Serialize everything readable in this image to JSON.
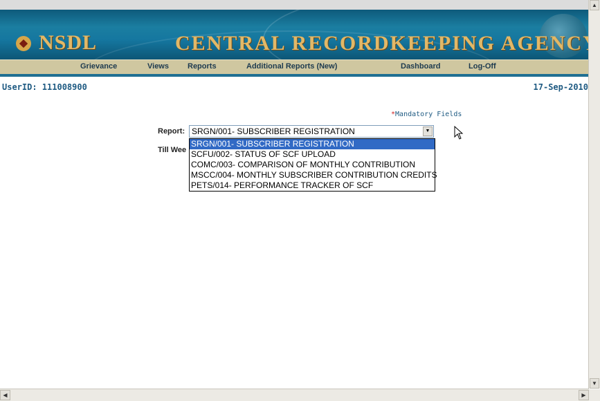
{
  "header": {
    "logo": "NSDL",
    "title": "CENTRAL RECORDKEEPING AGENCY"
  },
  "nav": {
    "items": [
      {
        "label": "Grievance"
      },
      {
        "label": "Views"
      },
      {
        "label": "Reports"
      },
      {
        "label": "Additional Reports (New)"
      },
      {
        "label": "Dashboard"
      },
      {
        "label": "Log-Off"
      }
    ]
  },
  "user": {
    "userid": "UserID: 111008900",
    "date": "17-Sep-2010"
  },
  "form": {
    "mandatory_star": "*",
    "mandatory_text": "Mandatory Fields",
    "report_label": "Report:",
    "report_selected": "SRGN/001- SUBSCRIBER REGISTRATION",
    "till_week_label": "Till Wee",
    "options": [
      "SRGN/001- SUBSCRIBER REGISTRATION",
      "SCFU/002- STATUS OF SCF UPLOAD",
      "COMC/003- COMPARISON OF MONTHLY CONTRIBUTION",
      "MSCC/004- MONTHLY SUBSCRIBER CONTRIBUTION CREDITS",
      "PETS/014- PERFORMANCE TRACKER OF SCF"
    ],
    "highlighted_option_index": 0
  },
  "colors": {
    "banner": "#1577a0",
    "nav_bg": "#cfc7a0",
    "highlight": "#316ac5",
    "title_gold": "#e2b867"
  }
}
